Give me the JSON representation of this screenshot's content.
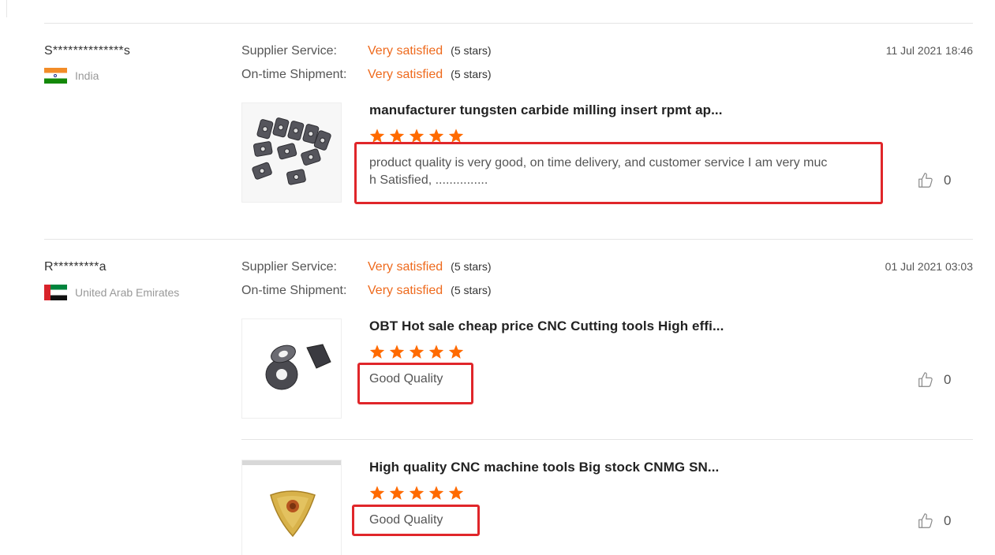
{
  "labels": {
    "supplier_service": "Supplier Service:",
    "ontime_shipment": "On-time Shipment:"
  },
  "reviews": [
    {
      "name": "S**************s",
      "country": "India",
      "date": "11 Jul 2021 18:46",
      "supplier_rating": "Very satisfied",
      "supplier_stars": "(5 stars)",
      "shipment_rating": "Very satisfied",
      "shipment_stars": "(5 stars)",
      "items": [
        {
          "title": "manufacturer tungsten carbide milling insert rpmt ap...",
          "stars": 5,
          "comment_line1": "product quality is very good, on time delivery, and customer service I am very muc",
          "comment_line2": "h Satisfied, ...............",
          "likes": "0"
        }
      ]
    },
    {
      "name": "R*********a",
      "country": "United Arab Emirates",
      "date": "01 Jul 2021 03:03",
      "supplier_rating": "Very satisfied",
      "supplier_stars": "(5 stars)",
      "shipment_rating": "Very satisfied",
      "shipment_stars": "(5 stars)",
      "items": [
        {
          "title": "OBT Hot sale cheap price CNC Cutting tools High effi...",
          "stars": 5,
          "comment": "Good Quality",
          "likes": "0"
        },
        {
          "title": "High quality CNC machine tools Big stock CNMG SN...",
          "stars": 5,
          "comment": "Good Quality",
          "likes": "0"
        }
      ]
    }
  ],
  "colors": {
    "accent_orange": "#ee6a1d",
    "highlight_red": "#e0262a"
  }
}
